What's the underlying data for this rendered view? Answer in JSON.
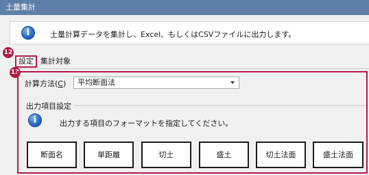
{
  "window": {
    "title": "土量集計"
  },
  "banner": {
    "icon": "info-icon",
    "icon_glyph": "i",
    "message": "土量計算データを集計し、Excel、もしくはCSVファイルに出力します。"
  },
  "callouts": {
    "tabs": "12",
    "panel": "13"
  },
  "tabs": [
    {
      "label": "設定",
      "selected": true
    },
    {
      "label": "集計対象",
      "selected": false
    }
  ],
  "calc_method": {
    "label_prefix": "計算方法(",
    "label_key": "C",
    "label_suffix": ")",
    "selected": "平均断面法"
  },
  "output_group": {
    "label": "出力項目設定",
    "icon": "info-icon",
    "icon_glyph": "i",
    "message": "出力する項目のフォーマットを指定してください。",
    "buttons": [
      "断面名",
      "単距離",
      "切土",
      "盛土",
      "切土法面",
      "盛土法面"
    ]
  },
  "colors": {
    "titlebar": "#5e7fa8",
    "highlight": "#b11a45",
    "info_icon": "#2a6cc4"
  }
}
